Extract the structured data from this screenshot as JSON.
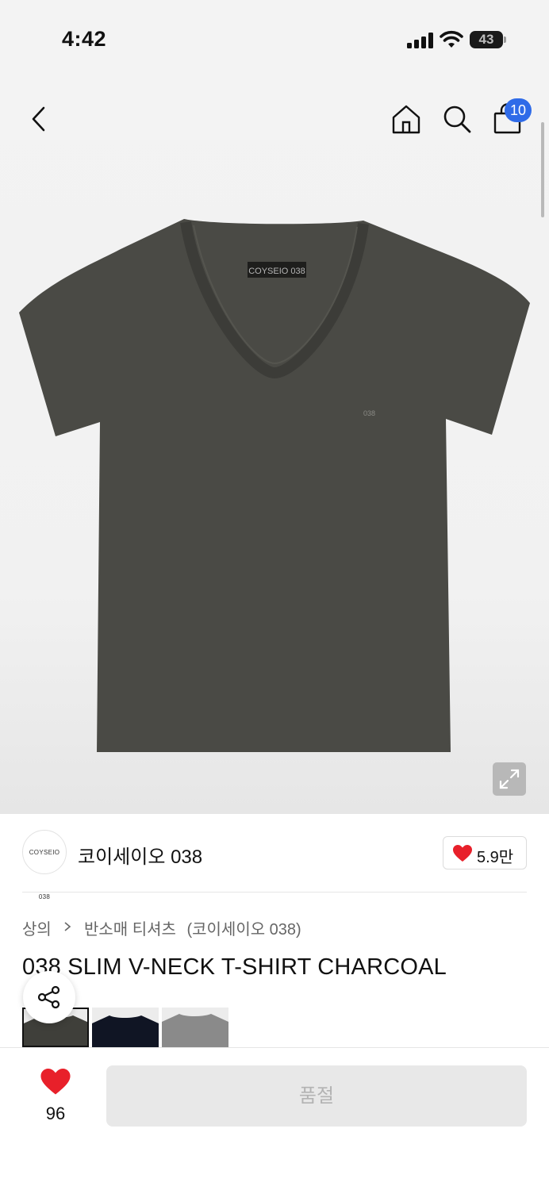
{
  "status_bar": {
    "time": "4:42",
    "battery": "43"
  },
  "header": {
    "cart_count": "10"
  },
  "product": {
    "colors": {
      "shirt": "#4a4a45",
      "accent_blue": "#2f6be8",
      "heart_red": "#e8202a"
    }
  },
  "brand": {
    "logo_text": "COYSEIO 038",
    "name": "코이세이오 038",
    "likes": "5.9만"
  },
  "breadcrumb": {
    "category": "상의",
    "subcategory": "반소매 티셔츠",
    "brand": "(코이세이오 038)"
  },
  "title": "038 SLIM V-NECK T-SHIRT CHARCOAL",
  "swatches": [
    {
      "color": "#3f3f3a",
      "selected": true
    },
    {
      "color": "#101524",
      "selected": false
    },
    {
      "color": "#8a8a8a",
      "selected": false
    }
  ],
  "bottom": {
    "wish_count": "96",
    "purchase_label": "품절"
  }
}
